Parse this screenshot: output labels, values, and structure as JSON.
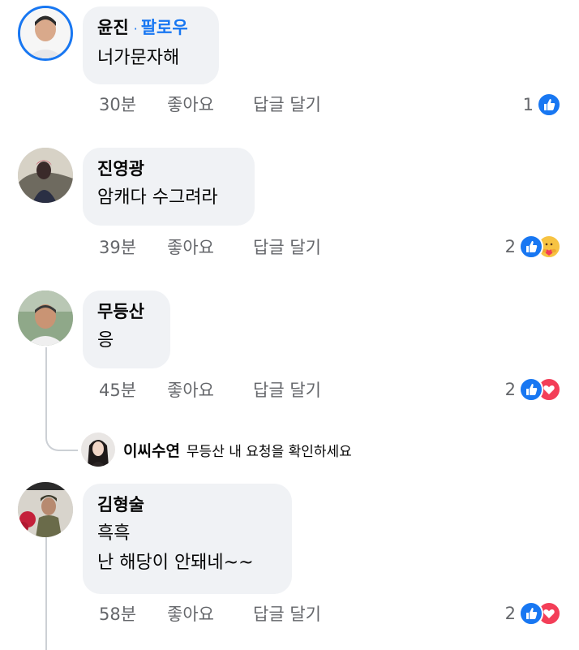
{
  "comments": [
    {
      "author": "윤진",
      "separator": "·",
      "follow_label": "팔로우",
      "text_lines": [
        "너가문자해"
      ],
      "time": "30분",
      "like_label": "좋아요",
      "reply_label": "답글 달기",
      "reaction_count": "1",
      "reactions": [
        "like-icon"
      ]
    },
    {
      "author": "진영광",
      "text_lines": [
        "암캐다 수그려라"
      ],
      "time": "39분",
      "like_label": "좋아요",
      "reply_label": "답글 달기",
      "reaction_count": "2",
      "reactions": [
        "like-icon",
        "care-icon"
      ]
    },
    {
      "author": "무등산",
      "text_lines": [
        "응"
      ],
      "time": "45분",
      "like_label": "좋아요",
      "reply_label": "답글 달기",
      "reaction_count": "2",
      "reactions": [
        "like-icon",
        "heart-icon"
      ]
    },
    {
      "author": "김형술",
      "text_lines": [
        "흑흑",
        "난 해당이 안돼네~~"
      ],
      "time": "58분",
      "like_label": "좋아요",
      "reply_label": "답글 달기",
      "reaction_count": "2",
      "reactions": [
        "like-icon",
        "heart-icon"
      ]
    }
  ],
  "reply": {
    "author": "이씨수연",
    "text": "무등산 내 요청을 확인하세요"
  },
  "colors": {
    "accent": "#1877f2",
    "bubble": "#f0f2f5",
    "meta_text": "#65676b",
    "heart": "#f33e58",
    "care": "#f7c342"
  }
}
